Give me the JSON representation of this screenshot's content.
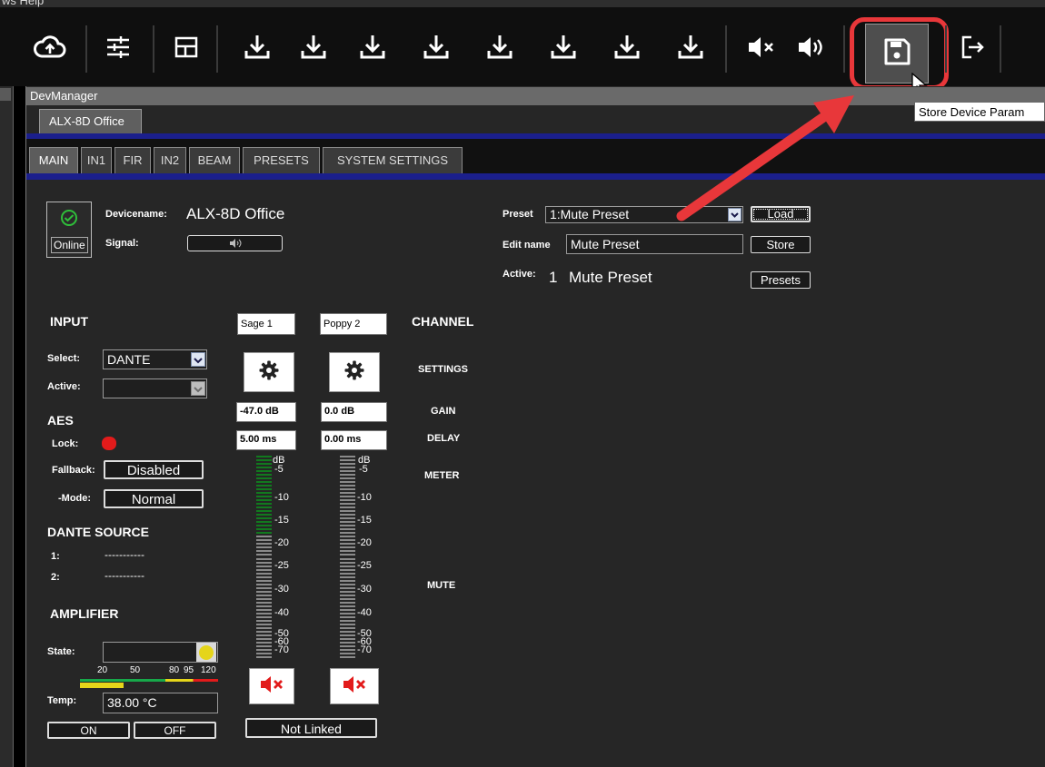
{
  "menu": {
    "text": "ws   Help"
  },
  "toolbar": {
    "icons": [
      "cloud-upload-icon",
      "mixer-sliders-icon",
      "layout-icon",
      "download-icon",
      "download-icon",
      "download-icon",
      "download-icon",
      "download-icon",
      "download-icon",
      "download-icon",
      "download-icon",
      "mute-all-icon",
      "unmute-all-icon",
      "save-icon",
      "exit-icon"
    ],
    "tooltip": "Store Device Param"
  },
  "window": {
    "title": "DevManager",
    "device_tab": "ALX-8D Office"
  },
  "tabs": [
    "MAIN",
    "IN1",
    "FIR",
    "IN2",
    "BEAM",
    "PRESETS",
    "SYSTEM SETTINGS"
  ],
  "device": {
    "status": "Online",
    "name_label": "Devicename:",
    "name_value": "ALX-8D Office",
    "signal_label": "Signal:"
  },
  "preset": {
    "label": "Preset",
    "selected": "1:Mute Preset",
    "load_label": "Load",
    "edit_label": "Edit name",
    "edit_value": "Mute Preset",
    "store_label": "Store",
    "active_label": "Active:",
    "active_number": "1",
    "active_name": "Mute Preset",
    "presets_label": "Presets"
  },
  "input": {
    "title": "INPUT",
    "select_label": "Select:",
    "select_value": "DANTE",
    "active_label": "Active:",
    "active_value": ""
  },
  "aes": {
    "title": "AES",
    "lock_label": "Lock:",
    "fallback_label": "Fallback:",
    "fallback_value": "Disabled",
    "mode_label": "-Mode:",
    "mode_value": "Normal"
  },
  "dante": {
    "title": "DANTE SOURCE",
    "rows": [
      {
        "num": "1:",
        "value": "-----------"
      },
      {
        "num": "2:",
        "value": "-----------"
      }
    ]
  },
  "amplifier": {
    "title": "AMPLIFIER",
    "state_label": "State:",
    "temp_scale": [
      "20",
      "50",
      "80",
      "95",
      "120"
    ],
    "temp_label": "Temp:",
    "temp_value": "38.00 °C",
    "on_label": "ON",
    "off_label": "OFF"
  },
  "channels": [
    {
      "name": "Sage 1",
      "gain": "-47.0 dB",
      "delay": "5.00 ms",
      "meter_level": 0.4
    },
    {
      "name": "Poppy 2",
      "gain": "0.0 dB",
      "delay": "0.00 ms",
      "meter_level": 0.0
    }
  ],
  "meter_scale": [
    "dB",
    "-5",
    "-10",
    "-15",
    "-20",
    "-25",
    "-30",
    "-40",
    "-50",
    "-60",
    "-70"
  ],
  "channel_labels": {
    "title": "CHANNEL",
    "settings": "SETTINGS",
    "gain": "GAIN",
    "delay": "DELAY",
    "meter": "METER",
    "mute": "MUTE"
  },
  "link_label": "Not Linked",
  "colors": {
    "accent_blue": "#1b1f8c",
    "highlight_red": "#e8373a",
    "meter_green": "#117a1e",
    "lock_red": "#e21b1b",
    "state_yellow": "#e5d51a"
  }
}
